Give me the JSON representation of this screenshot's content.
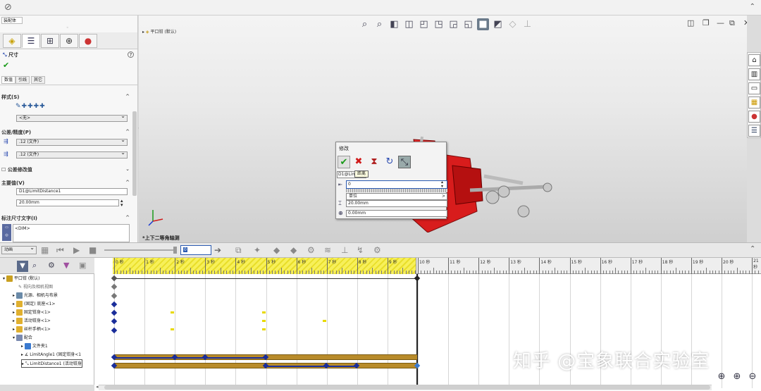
{
  "top": {
    "tab": "装配体"
  },
  "property_manager": {
    "title": "尺寸",
    "help": "?",
    "tabs": [
      "数值",
      "引线",
      "其它"
    ],
    "style": {
      "label": "样式(S)",
      "value": "<无>"
    },
    "tolerance": {
      "label": "公差/精度(P)",
      "precision1": ".12 (文件)",
      "precision2": ".12 (文件)"
    },
    "tolerance_mod": {
      "label": "公差修改值"
    },
    "primary": {
      "label": "主要值(V)",
      "name": "D1@LimitDistance1",
      "value": "20.00mm"
    },
    "dim_text": {
      "label": "标注尺寸文字(I)",
      "value": "<DIM>"
    }
  },
  "viewport": {
    "tree_title": "平口钳 (默认)",
    "view_name": "*上下二等角轴测"
  },
  "modify_dialog": {
    "title": "修改",
    "tooltip": "距离",
    "name": "D1@LimitDistance1",
    "input_value": "0",
    "unit_label": "单位",
    "row2": "20.00mm",
    "row3": "0.00mm"
  },
  "animation": {
    "mode": "动画",
    "time_field": "0"
  },
  "tree": {
    "items": [
      {
        "label": "平口钳  (默认)",
        "color": "#c9a020"
      },
      {
        "label": "视向及相机视图",
        "color": "#888888"
      },
      {
        "label": "光源、相机与布景",
        "color": "#6a8aa8"
      },
      {
        "label": "(固定) 底座<1>",
        "color": "#e0b030"
      },
      {
        "label": "固定钳身<1>",
        "color": "#e0b030"
      },
      {
        "label": "活动钳身<1>",
        "color": "#e0b030"
      },
      {
        "label": "丝杆手柄<1>",
        "color": "#e0b030"
      },
      {
        "label": "配合",
        "color": "#7a8ab0"
      },
      {
        "label": "文件夹1",
        "color": "#3a7ad0"
      },
      {
        "label": "LimitAngle1 (固定钳身<1",
        "color": "#666666"
      },
      {
        "label": "LimitDistance1 (活动钳身",
        "color": "#666666"
      }
    ]
  },
  "timeline": {
    "ticks": [
      "0 秒",
      "1 秒",
      "2 秒",
      "3 秒",
      "4 秒",
      "5 秒",
      "6 秒",
      "7 秒",
      "8 秒",
      "9 秒",
      "10 秒",
      "11 秒",
      "12 秒",
      "13 秒",
      "14 秒",
      "15 秒",
      "16 秒",
      "17 秒",
      "18 秒",
      "19 秒",
      "20 秒",
      "21 秒"
    ]
  },
  "watermark": "知乎 @宝象联合实验室",
  "colors": {
    "accent": "#1a2d9a",
    "bar": "#b88b2a",
    "ruler": "#f0e640",
    "part": "#d81c1c"
  }
}
